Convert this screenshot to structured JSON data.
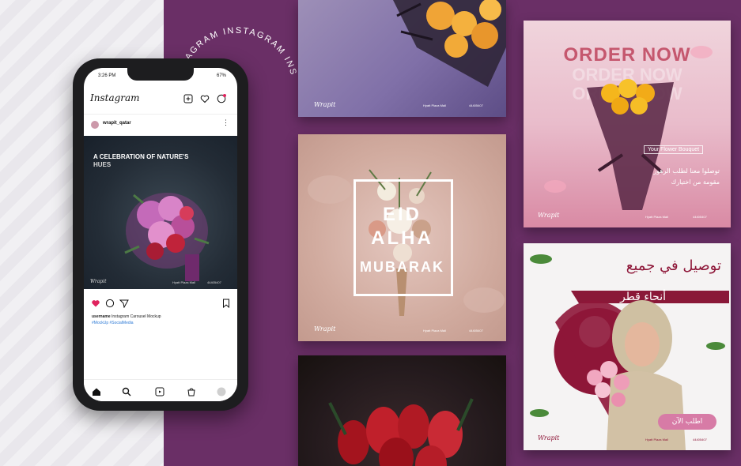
{
  "circular_text": "INSTAGRAM INSTAGRAM INS",
  "phone": {
    "status_time": "3:26 PM",
    "status_battery": "67%",
    "app_title": "Instagram",
    "profile_name": "wrapit_qatar",
    "post": {
      "title_line1": "A CELEBRATION OF NATURE'S",
      "title_line2": "HUES",
      "brand": "Wrapit",
      "footer_left": "Hyatt Plaza Mall",
      "footer_right": "44405407"
    },
    "caption": {
      "user": "username",
      "text": "Instagram Carousel Mockup",
      "tags": "#MockUp #SocialMedia"
    }
  },
  "cards": {
    "top_left": {
      "brand": "Wrapit",
      "location": "Hyatt Plaza Mall",
      "phone": "44405407"
    },
    "eid": {
      "line1": "EID",
      "line2": "ALHA",
      "line3": "MUBARAK",
      "brand": "Wrapit",
      "location": "Hyatt Plaza Mall",
      "phone": "44405407"
    },
    "order": {
      "headline": "ORDER NOW",
      "ghost1": "ORDER NOW",
      "ghost2": "ORDER NOW",
      "bouquet_label": "Your Flower Bouquet",
      "arabic_line1": "توصلوا معنا لطلب الرهور",
      "arabic_line2": "مقومة من اختيارك",
      "brand": "Wrapit",
      "location": "Hyatt Plaza Mall",
      "phone": "44405407"
    },
    "delivery": {
      "arabic_title": "توصيل في جميع",
      "arabic_subtitle": "أنحاء قطر",
      "button_label": "اطلب الآن",
      "brand": "Wrapit",
      "location": "Hyatt Plaza Mall",
      "phone": "44405407"
    }
  },
  "colors": {
    "purple_bg": "#6a2f66",
    "accent_pink": "#c5576e",
    "like_red": "#e0245e",
    "link_blue": "#2f7bd6"
  }
}
